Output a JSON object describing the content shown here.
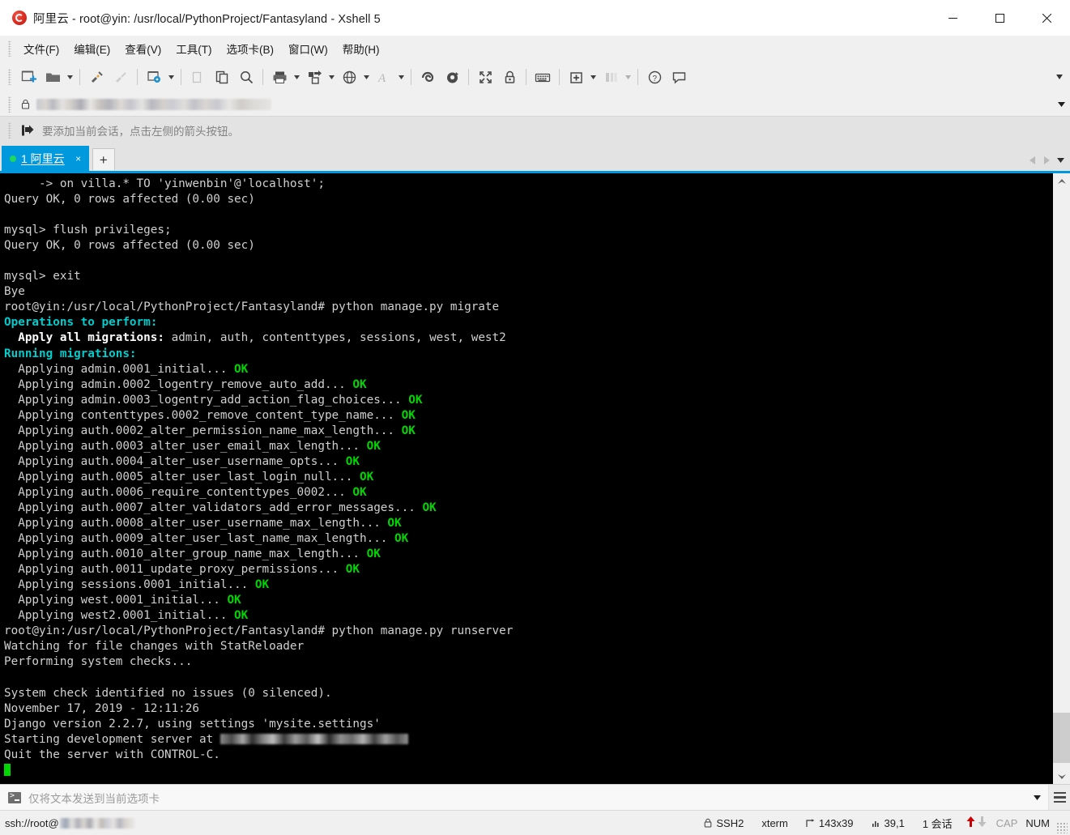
{
  "window": {
    "title": "阿里云 - root@yin: /usr/local/PythonProject/Fantasyland - Xshell 5",
    "app_icon": "alibaba-cloud-icon",
    "minimize": "−",
    "maximize": "□",
    "close": "✕"
  },
  "menubar": {
    "items": [
      {
        "label": "文件(F)",
        "name": "menu-file"
      },
      {
        "label": "编辑(E)",
        "name": "menu-edit"
      },
      {
        "label": "查看(V)",
        "name": "menu-view"
      },
      {
        "label": "工具(T)",
        "name": "menu-tools"
      },
      {
        "label": "选项卡(B)",
        "name": "menu-tabs"
      },
      {
        "label": "窗口(W)",
        "name": "menu-window"
      },
      {
        "label": "帮助(H)",
        "name": "menu-help"
      }
    ]
  },
  "toolbar": {
    "icons": [
      "new-session-icon",
      "open-folder-icon",
      "connect-icon",
      "disconnect-icon",
      "session-properties-icon",
      "copy-session-icon",
      "paste-icon",
      "find-icon",
      "print-icon",
      "transfer-file-icon",
      "globe-icon",
      "font-icon",
      "ssh-tunnel-icon",
      "nav-icon",
      "fullscreen-icon",
      "lock-icon",
      "keyboard-icon",
      "add-to-folder-icon",
      "layout-icon",
      "help-icon",
      "chat-icon"
    ],
    "overflow": "▾"
  },
  "addressbar": {
    "lock_icon": "lock-icon",
    "value": "",
    "redacted": true,
    "dropdown": "▾"
  },
  "notice": {
    "icon": "add-session-arrow-icon",
    "text": "要添加当前会话，点击左侧的箭头按钮。"
  },
  "tabs": {
    "active": {
      "label": "1 阿里云",
      "status_dot": "connected",
      "close": "×"
    },
    "new_tab": "+",
    "nav_prev": "◀",
    "nav_next": "▶",
    "menu": "▾"
  },
  "terminal": {
    "columns": 143,
    "rows": 39,
    "lines": [
      {
        "segs": [
          {
            "t": "     -> on villa.* TO 'yinwenbin'@'localhost';",
            "c": "c-white"
          }
        ]
      },
      {
        "segs": [
          {
            "t": "Query OK, 0 rows affected (0.00 sec)",
            "c": "c-white"
          }
        ]
      },
      {
        "segs": [
          {
            "t": "",
            "c": "c-white"
          }
        ]
      },
      {
        "segs": [
          {
            "t": "mysql> flush privileges;",
            "c": "c-white"
          }
        ]
      },
      {
        "segs": [
          {
            "t": "Query OK, 0 rows affected (0.00 sec)",
            "c": "c-white"
          }
        ]
      },
      {
        "segs": [
          {
            "t": "",
            "c": "c-white"
          }
        ]
      },
      {
        "segs": [
          {
            "t": "mysql> exit",
            "c": "c-white"
          }
        ]
      },
      {
        "segs": [
          {
            "t": "Bye",
            "c": "c-white"
          }
        ]
      },
      {
        "segs": [
          {
            "t": "root@yin:/usr/local/PythonProject/Fantasyland# python manage.py migrate",
            "c": "c-white"
          }
        ]
      },
      {
        "segs": [
          {
            "t": "Operations to perform:",
            "c": "c-cyan"
          }
        ]
      },
      {
        "segs": [
          {
            "t": "  Apply all migrations:",
            "c": "c-bwhite"
          },
          {
            "t": " admin, auth, contenttypes, sessions, west, west2",
            "c": "c-white"
          }
        ]
      },
      {
        "segs": [
          {
            "t": "Running migrations:",
            "c": "c-cyan"
          }
        ]
      },
      {
        "segs": [
          {
            "t": "  Applying admin.0001_initial...",
            "c": "c-white"
          },
          {
            "t": " OK",
            "c": "c-green"
          }
        ]
      },
      {
        "segs": [
          {
            "t": "  Applying admin.0002_logentry_remove_auto_add...",
            "c": "c-white"
          },
          {
            "t": " OK",
            "c": "c-green"
          }
        ]
      },
      {
        "segs": [
          {
            "t": "  Applying admin.0003_logentry_add_action_flag_choices...",
            "c": "c-white"
          },
          {
            "t": " OK",
            "c": "c-green"
          }
        ]
      },
      {
        "segs": [
          {
            "t": "  Applying contenttypes.0002_remove_content_type_name...",
            "c": "c-white"
          },
          {
            "t": " OK",
            "c": "c-green"
          }
        ]
      },
      {
        "segs": [
          {
            "t": "  Applying auth.0002_alter_permission_name_max_length...",
            "c": "c-white"
          },
          {
            "t": " OK",
            "c": "c-green"
          }
        ]
      },
      {
        "segs": [
          {
            "t": "  Applying auth.0003_alter_user_email_max_length...",
            "c": "c-white"
          },
          {
            "t": " OK",
            "c": "c-green"
          }
        ]
      },
      {
        "segs": [
          {
            "t": "  Applying auth.0004_alter_user_username_opts...",
            "c": "c-white"
          },
          {
            "t": " OK",
            "c": "c-green"
          }
        ]
      },
      {
        "segs": [
          {
            "t": "  Applying auth.0005_alter_user_last_login_null...",
            "c": "c-white"
          },
          {
            "t": " OK",
            "c": "c-green"
          }
        ]
      },
      {
        "segs": [
          {
            "t": "  Applying auth.0006_require_contenttypes_0002...",
            "c": "c-white"
          },
          {
            "t": " OK",
            "c": "c-green"
          }
        ]
      },
      {
        "segs": [
          {
            "t": "  Applying auth.0007_alter_validators_add_error_messages...",
            "c": "c-white"
          },
          {
            "t": " OK",
            "c": "c-green"
          }
        ]
      },
      {
        "segs": [
          {
            "t": "  Applying auth.0008_alter_user_username_max_length...",
            "c": "c-white"
          },
          {
            "t": " OK",
            "c": "c-green"
          }
        ]
      },
      {
        "segs": [
          {
            "t": "  Applying auth.0009_alter_user_last_name_max_length...",
            "c": "c-white"
          },
          {
            "t": " OK",
            "c": "c-green"
          }
        ]
      },
      {
        "segs": [
          {
            "t": "  Applying auth.0010_alter_group_name_max_length...",
            "c": "c-white"
          },
          {
            "t": " OK",
            "c": "c-green"
          }
        ]
      },
      {
        "segs": [
          {
            "t": "  Applying auth.0011_update_proxy_permissions...",
            "c": "c-white"
          },
          {
            "t": " OK",
            "c": "c-green"
          }
        ]
      },
      {
        "segs": [
          {
            "t": "  Applying sessions.0001_initial...",
            "c": "c-white"
          },
          {
            "t": " OK",
            "c": "c-green"
          }
        ]
      },
      {
        "segs": [
          {
            "t": "  Applying west.0001_initial...",
            "c": "c-white"
          },
          {
            "t": " OK",
            "c": "c-green"
          }
        ]
      },
      {
        "segs": [
          {
            "t": "  Applying west2.0001_initial...",
            "c": "c-white"
          },
          {
            "t": " OK",
            "c": "c-green"
          }
        ]
      },
      {
        "segs": [
          {
            "t": "root@yin:/usr/local/PythonProject/Fantasyland# python manage.py runserver",
            "c": "c-white"
          }
        ]
      },
      {
        "segs": [
          {
            "t": "Watching for file changes with StatReloader",
            "c": "c-white"
          }
        ]
      },
      {
        "segs": [
          {
            "t": "Performing system checks...",
            "c": "c-white"
          }
        ]
      },
      {
        "segs": [
          {
            "t": "",
            "c": "c-white"
          }
        ]
      },
      {
        "segs": [
          {
            "t": "System check identified no issues (0 silenced).",
            "c": "c-white"
          }
        ]
      },
      {
        "segs": [
          {
            "t": "November 17, 2019 - 12:11:26",
            "c": "c-white"
          }
        ]
      },
      {
        "segs": [
          {
            "t": "Django version 2.2.7, using settings 'mysite.settings'",
            "c": "c-white"
          }
        ]
      },
      {
        "segs": [
          {
            "t": "Starting development server at ",
            "c": "c-white"
          },
          {
            "blur": 232
          }
        ]
      },
      {
        "segs": [
          {
            "t": "Quit the server with CONTROL-C.",
            "c": "c-white"
          }
        ]
      },
      {
        "segs": [
          {
            "cursor": true
          }
        ]
      }
    ]
  },
  "sendbar": {
    "icon": "terminal-send-icon",
    "placeholder": "仅将文本发送到当前选项卡",
    "value": "",
    "dropdown": "▾",
    "list_icon": "list-icon"
  },
  "statusbar": {
    "url_prefix": "ssh://root@",
    "url_redacted": true,
    "cells": [
      {
        "icon": "lock-icon",
        "label": "SSH2",
        "name": "status-protocol"
      },
      {
        "icon": "",
        "label": "xterm",
        "name": "status-term-type"
      },
      {
        "icon": "resize-icon",
        "label": "143x39",
        "name": "status-size"
      },
      {
        "icon": "cursor-pos-icon",
        "label": "39,1",
        "name": "status-cursor-pos"
      },
      {
        "icon": "",
        "label": "1 会话",
        "name": "status-session-count"
      }
    ],
    "upload_arrow": "↑",
    "download_arrow": "↓",
    "caps": "CAP",
    "num": "NUM"
  },
  "colors": {
    "accent_blue": "#0099dd",
    "terminal_bg": "#000000",
    "terminal_fg": "#d0d0d0",
    "ok_green": "#00d700",
    "cyan": "#00cdcd",
    "chrome_gray": "#f0f0f0",
    "notice_gray": "#e3e3e3",
    "status_red": "#cc0000"
  }
}
